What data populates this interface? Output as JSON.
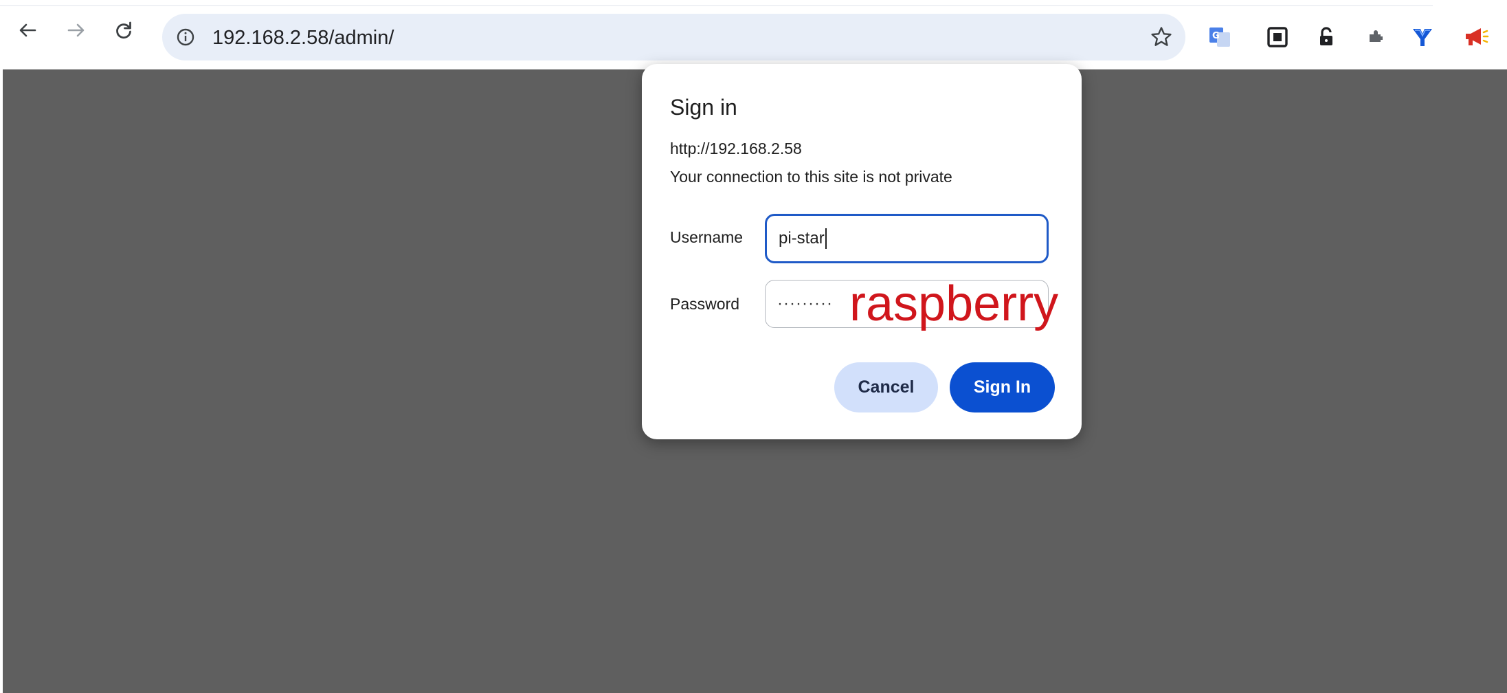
{
  "browser": {
    "url": "192.168.2.58/admin/",
    "nav": {
      "back_icon": "back-arrow-icon",
      "forward_icon": "forward-arrow-icon",
      "reload_icon": "reload-icon",
      "info_icon": "site-info-icon"
    },
    "bookmark_icon": "star-icon",
    "extensions": [
      "google-translate-icon",
      "extension-square-icon",
      "lock-icon",
      "puzzle-extension-icon",
      "blue-y-extension-icon",
      "megaphone-icon"
    ]
  },
  "dialog": {
    "title": "Sign in",
    "origin": "http://192.168.2.58",
    "warning": "Your connection to this site is not private",
    "username": {
      "label": "Username",
      "value": "pi-star"
    },
    "password": {
      "label": "Password",
      "masked_value": "·········"
    },
    "cancel_label": "Cancel",
    "signin_label": "Sign In"
  },
  "annotation": {
    "text": "raspberry",
    "color": "#d0161c"
  },
  "colors": {
    "accent": "#0b50d1",
    "focus_ring": "#1f5ac7",
    "cancel_bg": "#d2e0fb",
    "backdrop": "#5f5f5f",
    "omnibox_bg": "#e8eef8"
  }
}
